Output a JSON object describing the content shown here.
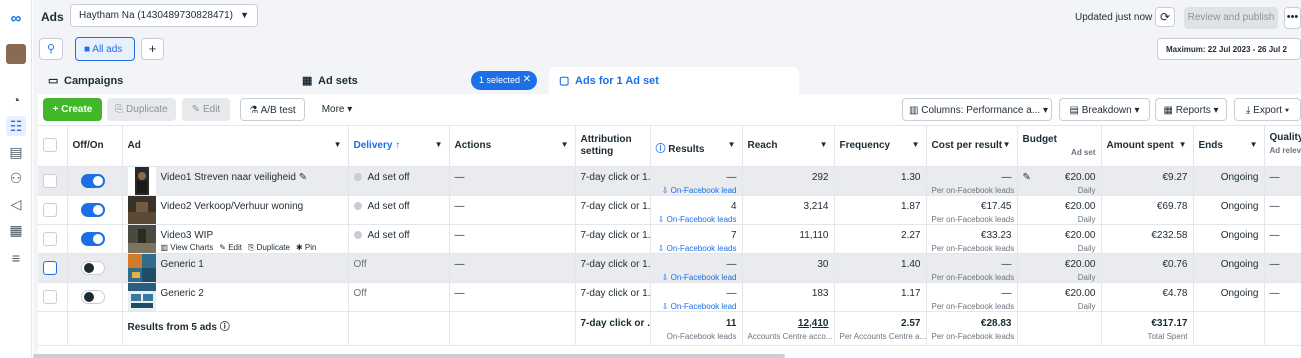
{
  "app": {
    "title": "Ads",
    "logo_icon": "meta-logo-icon"
  },
  "account": {
    "label": "Haytham Na (1430489730828471)"
  },
  "header": {
    "updated": "Updated just now",
    "review_publish": "Review and publish",
    "more": "•••"
  },
  "search": {
    "all_ads": "All ads",
    "add": "+"
  },
  "date_range": "Maximum: 22 Jul 2023 - 26 Jul 2",
  "tabs": {
    "campaigns": "Campaigns",
    "ad_sets": "Ad sets",
    "selected": "1 selected",
    "ads": "Ads for 1 Ad set"
  },
  "toolbar": {
    "create": "Create",
    "duplicate": "Duplicate",
    "edit": "Edit",
    "ab_test": "A/B test",
    "more": "More",
    "columns": "Columns: Performance a...",
    "breakdown": "Breakdown",
    "reports": "Reports",
    "export": "Export"
  },
  "columns": {
    "off_on": "Off/On",
    "ad": "Ad",
    "delivery": "Delivery ↑",
    "actions": "Actions",
    "attribution": "Attribution setting",
    "results": "Results",
    "reach": "Reach",
    "frequency": "Frequency",
    "cost": "Cost per result",
    "budget": "Budget",
    "budget_sub": "Ad set",
    "spent": "Amount spent",
    "ends": "Ends",
    "quality": "Quality ranking",
    "quality_sub": "Ad relev"
  },
  "rows": [
    {
      "name": "Video1 Streven naar veiligheid",
      "delivery": "Ad set off",
      "actions": "—",
      "attribution": "7-day click or 1...",
      "results": "—",
      "results_sub": "On-Facebook lead",
      "reach": "292",
      "frequency": "1.30",
      "cost": "—",
      "cost_sub": "Per on-Facebook leads",
      "budget": "€20.00",
      "budget_sub": "Daily",
      "spent": "€9.27",
      "ends": "Ongoing",
      "quality": "—"
    },
    {
      "name": "Video2 Verkoop/Verhuur woning",
      "delivery": "Ad set off",
      "actions": "—",
      "attribution": "7-day click or 1...",
      "results": "4",
      "results_sub": "On-Facebook leads",
      "reach": "3,214",
      "frequency": "1.87",
      "cost": "€17.45",
      "cost_sub": "Per on-Facebook leads",
      "budget": "€20.00",
      "budget_sub": "Daily",
      "spent": "€69.78",
      "ends": "Ongoing",
      "quality": "—"
    },
    {
      "name": "Video3 WIP",
      "delivery": "Ad set off",
      "actions": "—",
      "attribution": "7-day click or 1...",
      "results": "7",
      "results_sub": "On-Facebook leads",
      "reach": "11,110",
      "frequency": "2.27",
      "cost": "€33.23",
      "cost_sub": "Per on-Facebook leads",
      "budget": "€20.00",
      "budget_sub": "Daily",
      "spent": "€232.58",
      "ends": "Ongoing",
      "quality": "—",
      "view_charts": "View Charts",
      "edit": "Edit",
      "duplicate": "Duplicate",
      "pin": "Pin"
    },
    {
      "name": "Generic 1",
      "delivery": "Off",
      "actions": "—",
      "attribution": "7-day click or 1...",
      "results": "—",
      "results_sub": "On-Facebook lead",
      "reach": "30",
      "frequency": "1.40",
      "cost": "—",
      "cost_sub": "Per on-Facebook leads",
      "budget": "€20.00",
      "budget_sub": "Daily",
      "spent": "€0.76",
      "ends": "Ongoing",
      "quality": "—"
    },
    {
      "name": "Generic 2",
      "delivery": "Off",
      "actions": "—",
      "attribution": "7-day click or 1...",
      "results": "—",
      "results_sub": "On-Facebook lead",
      "reach": "183",
      "frequency": "1.17",
      "cost": "—",
      "cost_sub": "Per on-Facebook leads",
      "budget": "€20.00",
      "budget_sub": "Daily",
      "spent": "€4.78",
      "ends": "Ongoing",
      "quality": "—"
    }
  ],
  "footer": {
    "label": "Results from 5 ads",
    "attribution": "7-day click or ...",
    "results": "11",
    "results_sub": "On-Facebook leads",
    "reach": "12,410",
    "reach_sub": "Accounts Centre acco...",
    "frequency": "2.57",
    "frequency_sub": "Per Accounts Centre a...",
    "cost": "€28.83",
    "cost_sub": "Per on-Facebook leads",
    "spent": "€317.17",
    "spent_sub": "Total Spent"
  }
}
